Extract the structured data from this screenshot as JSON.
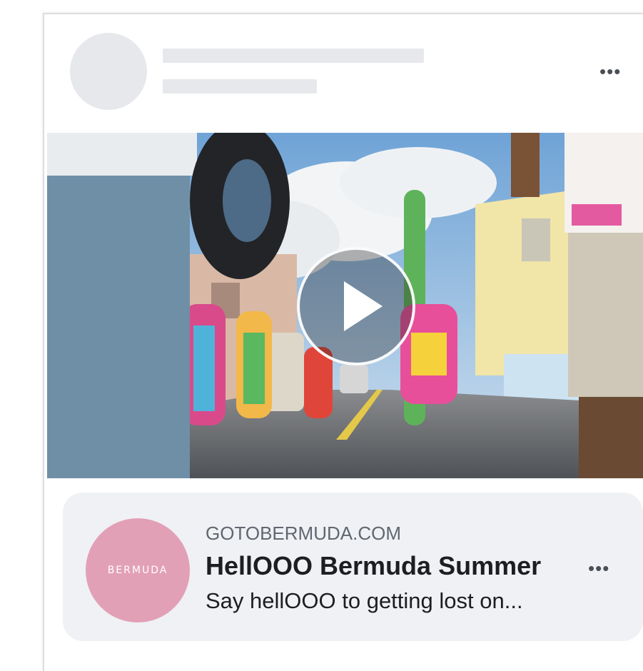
{
  "post": {
    "menu_icon": "more-horizontal-icon",
    "menu_glyph": "•••",
    "placeholder_color": "#e7e8ec"
  },
  "video": {
    "play_icon": "play-icon"
  },
  "link_preview": {
    "logo_text": "BERMUDA",
    "logo_color": "#e2a0b6",
    "domain": "GOTOBERMUDA.COM",
    "title": "HellOOO Bermuda Summer",
    "description": "Say hellOOO to getting lost on...",
    "menu_icon": "more-horizontal-icon",
    "menu_glyph": "•••"
  }
}
